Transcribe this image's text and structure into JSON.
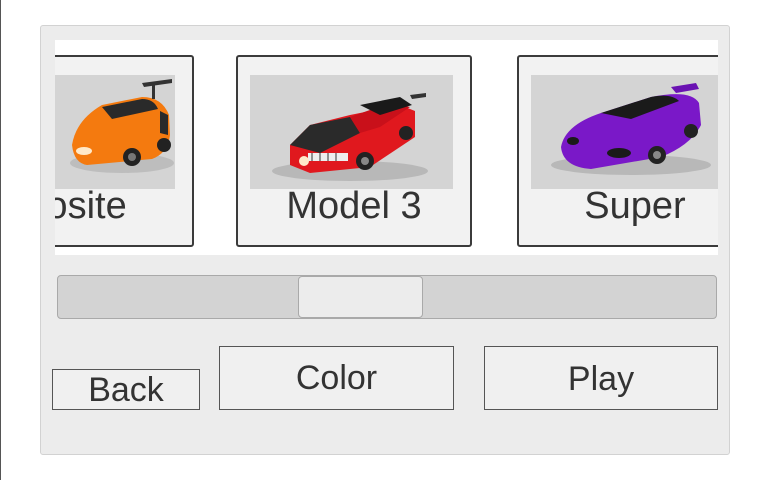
{
  "carousel": {
    "cards": [
      {
        "label": "posite",
        "color": "#f47a0f",
        "icon": "orange-sports-car-icon"
      },
      {
        "label": "Model 3",
        "color": "#e0181e",
        "icon": "red-sedan-car-icon"
      },
      {
        "label": "Super",
        "color": "#7a18c8",
        "icon": "purple-supercar-icon"
      }
    ]
  },
  "scrollbar": {
    "position": 0.45
  },
  "buttons": {
    "back": "Back",
    "color": "Color",
    "play": "Play"
  }
}
